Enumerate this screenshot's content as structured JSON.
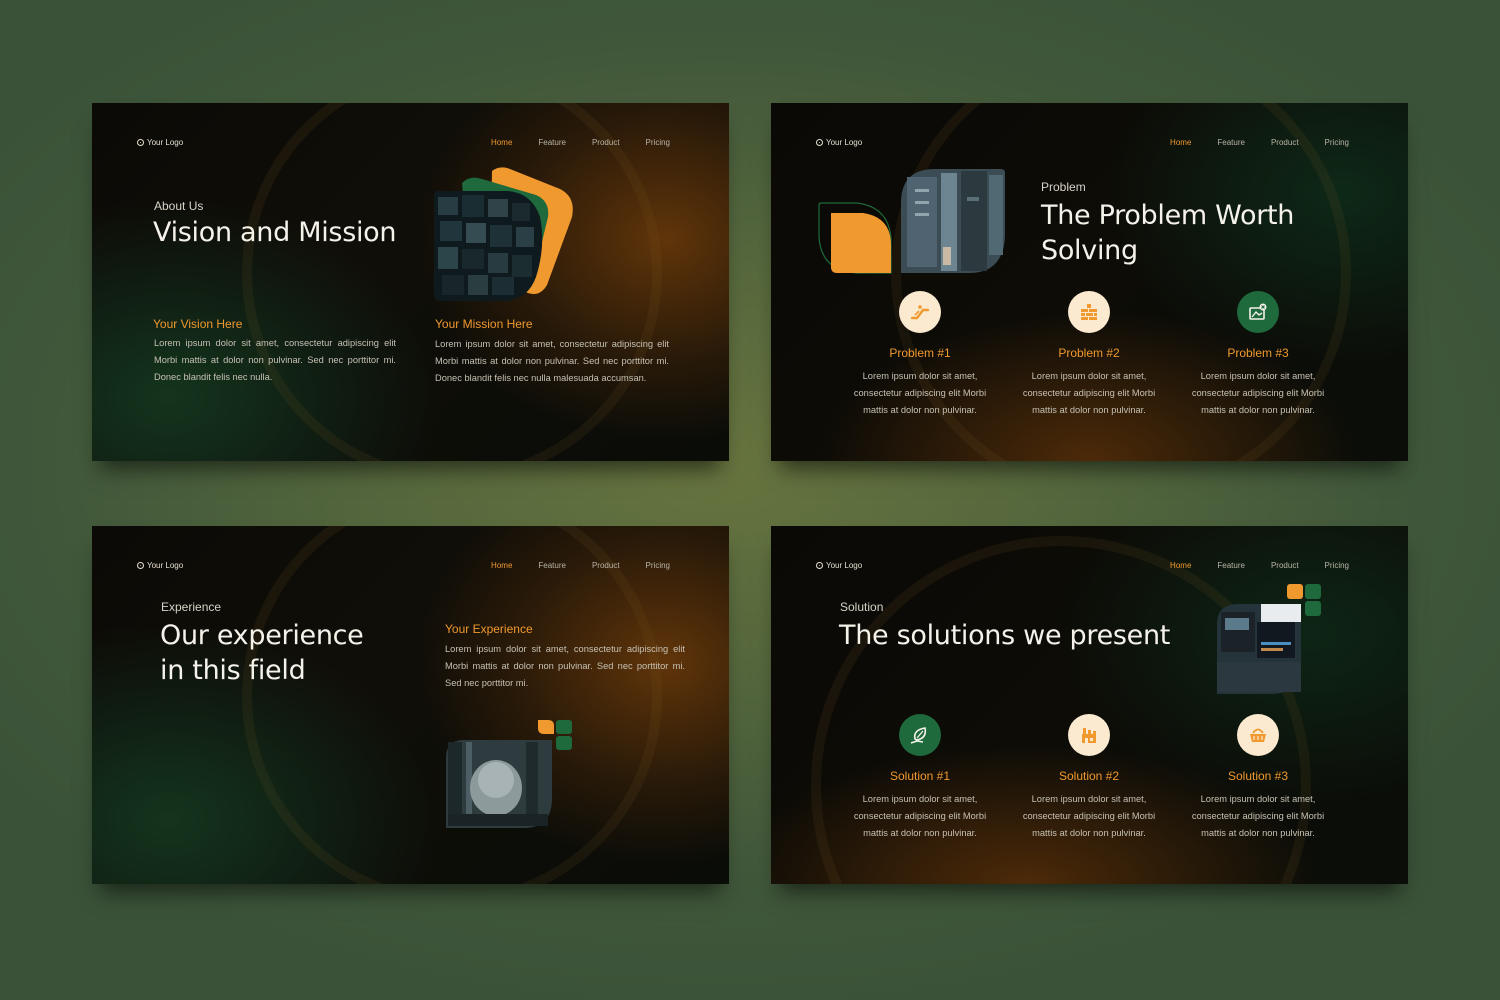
{
  "nav": {
    "logo_label": "Your Logo",
    "items": [
      "Home",
      "Feature",
      "Product",
      "Pricing"
    ]
  },
  "slides": [
    {
      "eyebrow": "About Us",
      "title": "Vision and Mission",
      "vision_title": "Your Vision Here",
      "vision_text": "Lorem ipsum dolor sit amet, consectetur adipiscing elit Morbi mattis at dolor non pulvinar. Sed nec porttitor mi. Donec blandit felis nec nulla.",
      "mission_title": "Your Mission Here",
      "mission_text": "Lorem ipsum dolor sit amet, consectetur adipiscing elit Morbi mattis at dolor non pulvinar. Sed nec porttitor mi. Donec blandit felis nec nulla malesuada accumsan."
    },
    {
      "eyebrow": "Problem",
      "title_line1": "The Problem Worth",
      "title_line2": "Solving",
      "items": [
        {
          "title": "Problem #1",
          "icon": "escalator-icon",
          "text": "Lorem ipsum dolor sit amet, consectetur adipiscing elit Morbi mattis at dolor non pulvinar."
        },
        {
          "title": "Problem #2",
          "icon": "brick-wall-icon",
          "text": "Lorem ipsum dolor sit amet, consectetur adipiscing elit Morbi mattis at dolor non pulvinar."
        },
        {
          "title": "Problem #3",
          "icon": "image-error-icon",
          "text": "Lorem ipsum dolor sit amet, consectetur adipiscing elit Morbi mattis at dolor non pulvinar."
        }
      ]
    },
    {
      "eyebrow": "Experience",
      "title_line1": "Our experience",
      "title_line2": "in this field",
      "exp_title": "Your Experience",
      "exp_text": "Lorem ipsum dolor sit amet, consectetur adipiscing elit Morbi mattis at dolor non pulvinar. Sed nec porttitor mi. Sed nec porttitor mi."
    },
    {
      "eyebrow": "Solution",
      "title": "The solutions we present",
      "items": [
        {
          "title": "Solution #1",
          "icon": "leaf-hand-icon",
          "text": "Lorem ipsum dolor sit amet, consectetur adipiscing elit Morbi mattis at dolor non pulvinar."
        },
        {
          "title": "Solution #2",
          "icon": "factory-icon",
          "text": "Lorem ipsum dolor sit amet, consectetur adipiscing elit Morbi mattis at dolor non pulvinar."
        },
        {
          "title": "Solution #3",
          "icon": "basket-icon",
          "text": "Lorem ipsum dolor sit amet, consectetur adipiscing elit Morbi mattis at dolor non pulvinar."
        }
      ]
    }
  ],
  "colors": {
    "accent": "#f0992e",
    "green": "#1f6a3c",
    "icon_bg_light": "#fbead0"
  }
}
